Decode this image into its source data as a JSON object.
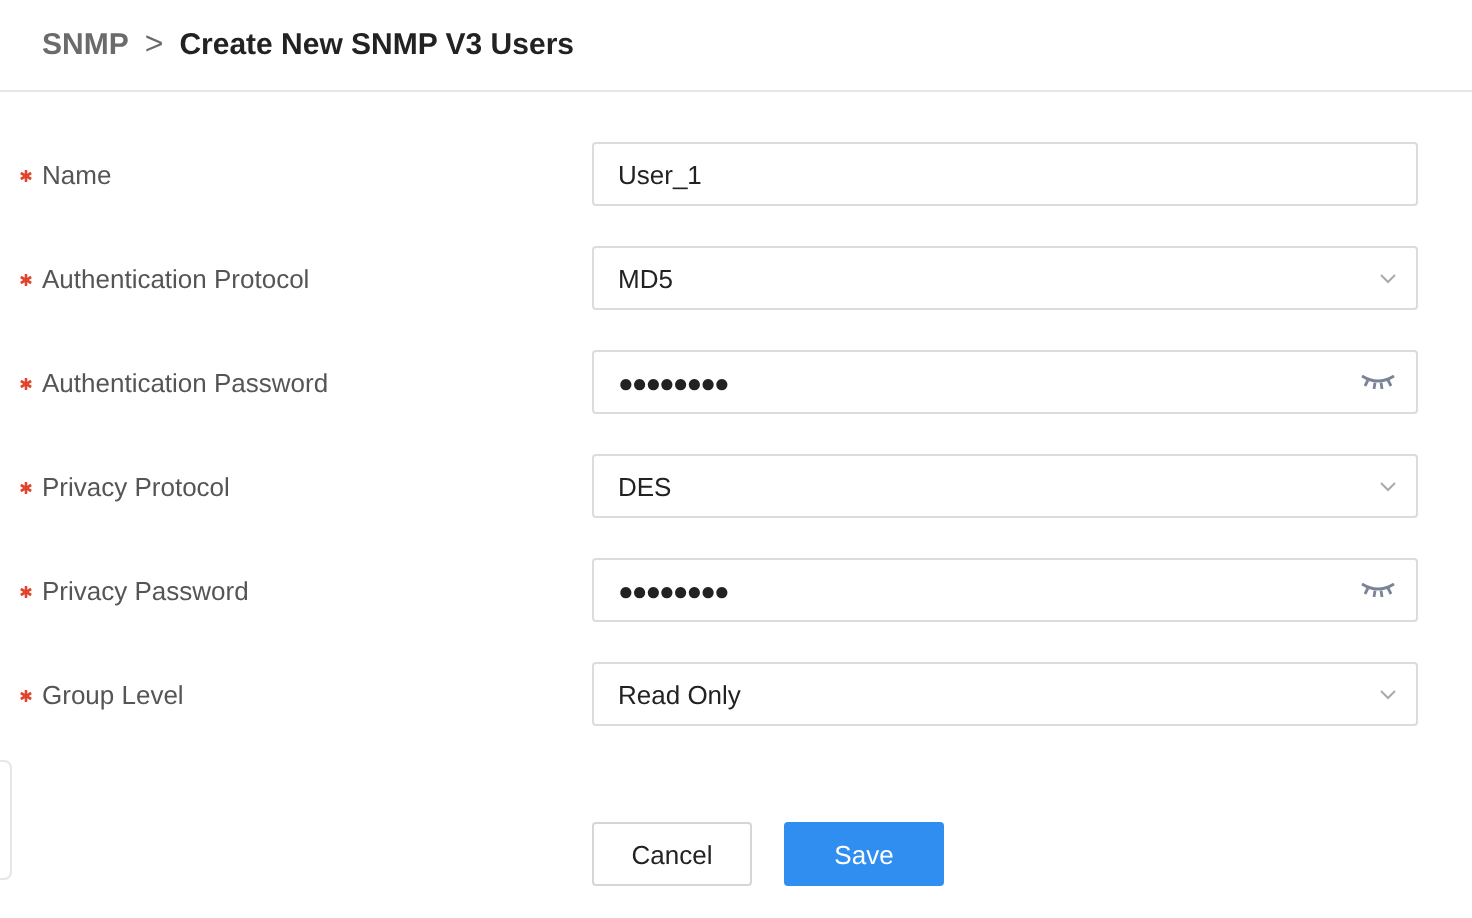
{
  "breadcrumb": {
    "parent": "SNMP",
    "separator": ">",
    "current": "Create New SNMP V3 Users"
  },
  "fields": [
    {
      "label": "Name",
      "required": true,
      "kind": "text",
      "value": "User_1"
    },
    {
      "label": "Authentication Protocol",
      "required": true,
      "kind": "select",
      "value": "MD5"
    },
    {
      "label": "Authentication Password",
      "required": true,
      "kind": "password",
      "value": "●●●●●●●●"
    },
    {
      "label": "Privacy Protocol",
      "required": true,
      "kind": "select",
      "value": "DES"
    },
    {
      "label": "Privacy Password",
      "required": true,
      "kind": "password",
      "value": "●●●●●●●●"
    },
    {
      "label": "Group Level",
      "required": true,
      "kind": "select",
      "value": "Read Only"
    }
  ],
  "buttons": [
    {
      "label": "Cancel",
      "primary": false
    },
    {
      "label": "Save",
      "primary": true
    }
  ]
}
